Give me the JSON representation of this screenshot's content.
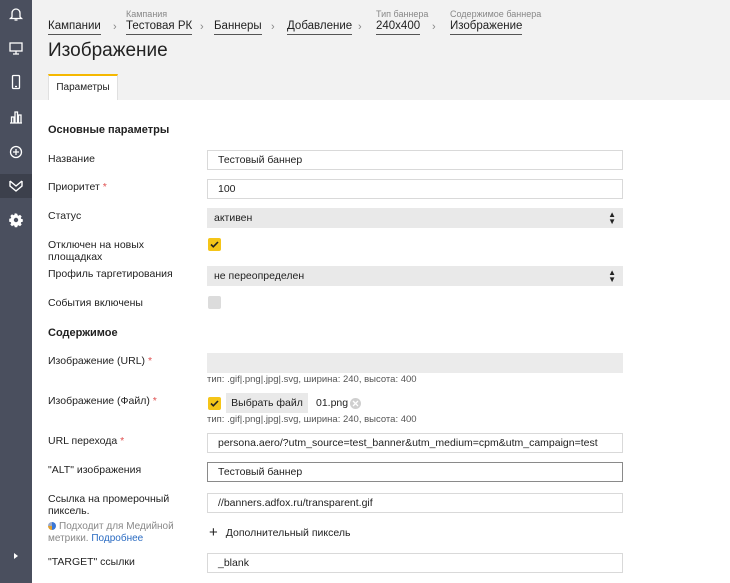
{
  "sidebar": {
    "icons": [
      "bell-icon",
      "monitor-icon",
      "mobile-icon",
      "stats-icon",
      "add-circle-icon",
      "banner-icon",
      "settings-icon",
      "expand-icon"
    ]
  },
  "breadcrumbs": [
    {
      "caption": "",
      "label": "Кампании"
    },
    {
      "caption": "Кампания",
      "label": "Тестовая РК"
    },
    {
      "caption": "",
      "label": "Баннеры"
    },
    {
      "caption": "",
      "label": "Добавление"
    },
    {
      "caption": "Тип баннера",
      "label": "240x400"
    },
    {
      "caption": "Содержимое баннера",
      "label": "Изображение"
    }
  ],
  "page": {
    "title": "Изображение",
    "tab": "Параметры"
  },
  "sections": {
    "main": "Основные параметры",
    "content": "Содержимое"
  },
  "fields": {
    "name": {
      "label": "Название",
      "value": "Тестовый баннер"
    },
    "priority": {
      "label": "Приоритет",
      "value": "100"
    },
    "status": {
      "label": "Статус",
      "value": "активен"
    },
    "disabled_new": {
      "label": "Отключен на новых площадках",
      "checked": true
    },
    "targeting": {
      "label": "Профиль таргетирования",
      "value": "не переопределен"
    },
    "events": {
      "label": "События включены",
      "checked": false
    },
    "image_url": {
      "label": "Изображение (URL)",
      "value": "",
      "hint": "тип: .gif|.png|.jpg|.svg, ширина: 240, высота: 400"
    },
    "image_file": {
      "label": "Изображение (Файл)",
      "button": "Выбрать файл",
      "filename": "01.png",
      "hint": "тип: .gif|.png|.jpg|.svg, ширина: 240, высота: 400"
    },
    "url": {
      "label": "URL перехода",
      "value": "persona.aero/?utm_source=test_banner&utm_medium=cpm&utm_campaign=test"
    },
    "alt": {
      "label": "\"ALT\" изображения",
      "value": "Тестовый баннер"
    },
    "pixel": {
      "label": "Ссылка на промерочный пиксель.",
      "value": "//banners.adfox.ru/transparent.gif",
      "note": "Подходит для Медийной метрики.",
      "note_link": "Подробнее",
      "add_label": "Дополнительный пиксель"
    },
    "target": {
      "label": "\"TARGET\" ссылки",
      "value": "_blank"
    }
  },
  "colors": {
    "accent": "#f5c518",
    "sidebar": "#4a4f5e",
    "header": "#f2f2f2"
  }
}
